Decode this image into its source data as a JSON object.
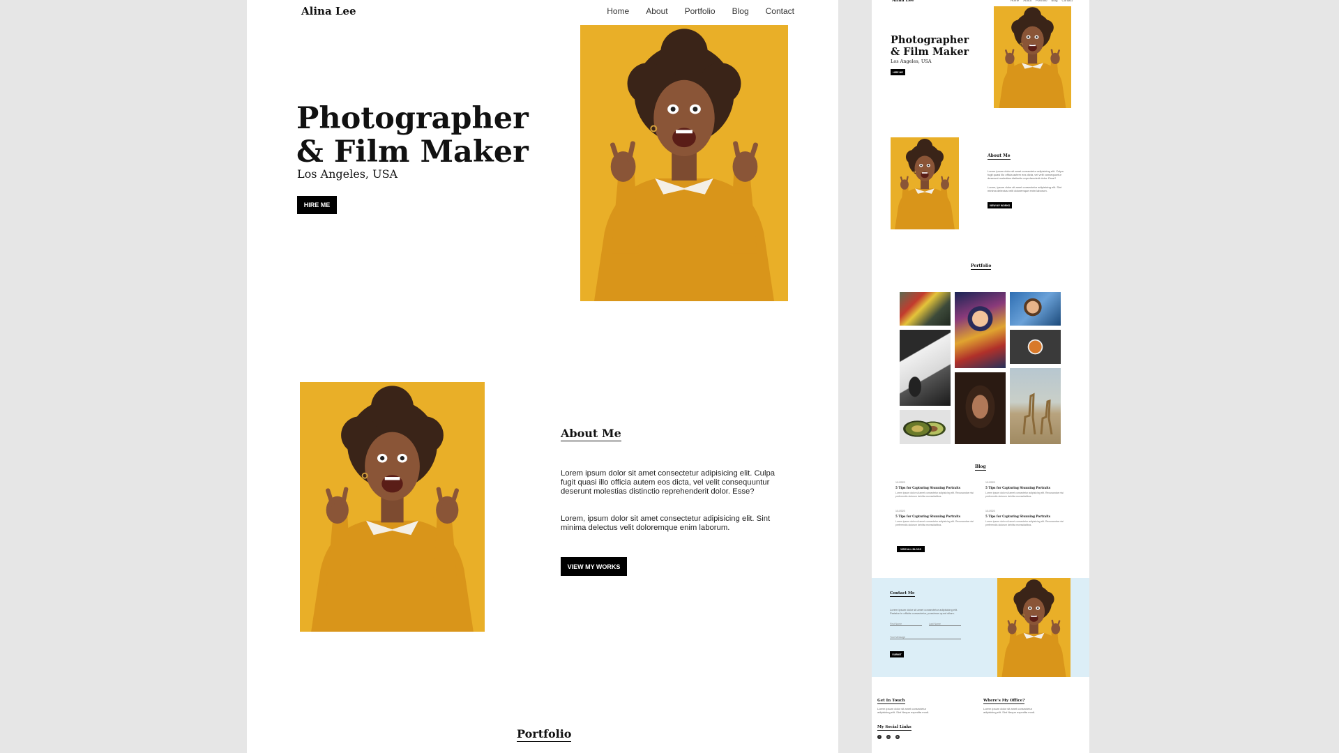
{
  "site": {
    "brand": "Alina Lee",
    "nav": [
      "Home",
      "About",
      "Portfolio",
      "Blog",
      "Contact"
    ]
  },
  "hero": {
    "title_line1": "Photographer",
    "title_line2": "& Film Maker",
    "subtitle": "Los Angeles, USA",
    "button": "HIRE ME"
  },
  "about": {
    "title": "About Me",
    "p1": "Lorem ipsum dolor sit amet consectetur adipisicing elit. Culpa fugit quasi illo officia autem eos dicta, vel velit consequuntur deserunt molestias distinctio reprehenderit dolor. Esse?",
    "p2": "Lorem, ipsum dolor sit amet consectetur adipisicing elit. Sint minima delectus velit doloremque enim laborum.",
    "button": "VIEW MY WORKS"
  },
  "portfolio": {
    "title": "Portfolio",
    "tiles": [
      "city-street",
      "painted-portrait",
      "child-portrait",
      "white-car",
      "food-plate",
      "woman-portrait",
      "giraffes",
      "avocado"
    ]
  },
  "blog": {
    "title": "Blog",
    "post_date": "1/1/2023",
    "post_title": "5 Tips for Capturing Stunning Portraits",
    "post_snippet": "Lorem ipsum dolor sit amet consectetur adipisicing elit. Recusandae nisi perferendis dolorum debitis necessitatibus.",
    "button": "VIEW ALL BLOGS"
  },
  "contact": {
    "title": "Contact Me",
    "text": "Lorem ipsum dolor sit amet consectetur adipisicing elit. Pariatur in officiis consectetur, possimus quod ullam.",
    "first_name": "First Name",
    "last_name": "Last Name",
    "message": "Your Message",
    "button": "SUBMIT",
    "background": "#dceef7"
  },
  "footer": {
    "get_in_touch": "Get In Touch",
    "touch_text": "Lorem ipsum dolor sit amet consectetur adipisicing elit. Sint Neque expedita modi.",
    "office": "Where's My Office?",
    "office_text": "Lorem ipsum dolor sit amet consectetur adipisicing elit. Sint Neque expedita modi.",
    "social_title": "My Social Links",
    "social_icons": [
      "facebook-icon",
      "instagram-icon",
      "linkedin-icon"
    ]
  },
  "colors": {
    "page_bg": "#e6e6e6",
    "accent_yellow": "#e9ad1d",
    "button": "#000000"
  }
}
